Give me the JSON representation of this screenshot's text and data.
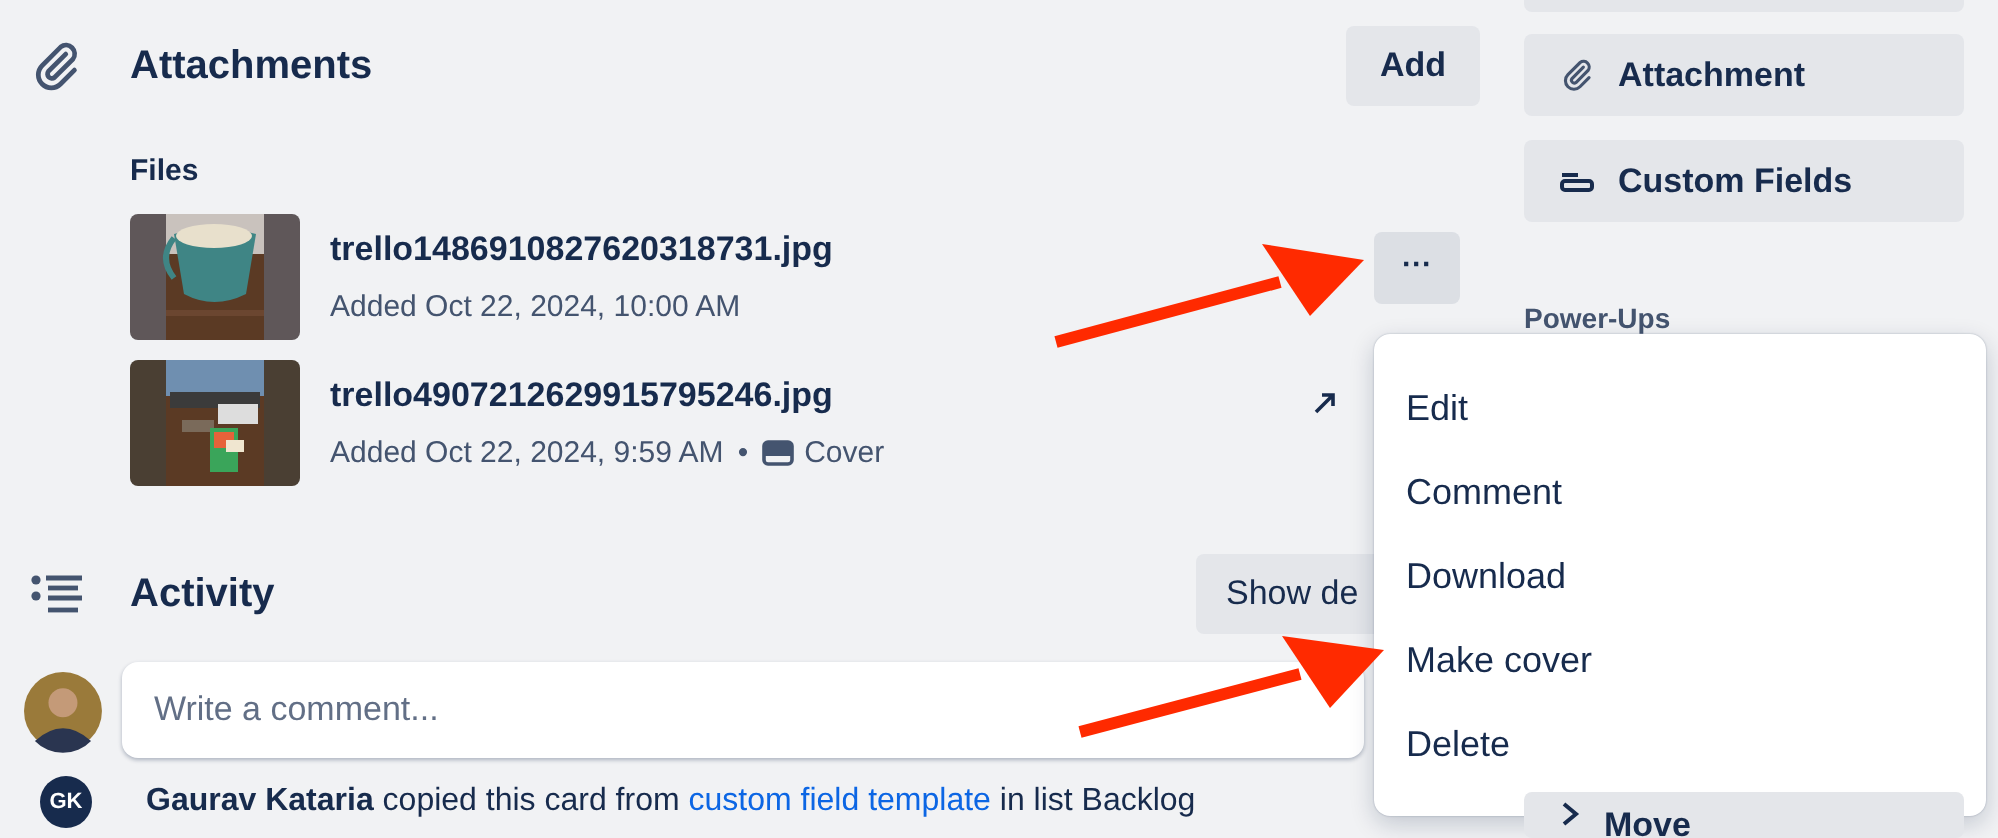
{
  "attachments": {
    "title": "Attachments",
    "add_button": "Add",
    "files_label": "Files",
    "files": [
      {
        "name": "trello1486910827620318731.jpg",
        "added": "Added Oct 22, 2024, 10:00 AM",
        "hovered": true,
        "more_button": "···"
      },
      {
        "name": "trello4907212629915795246.jpg",
        "added": "Added Oct 22, 2024, 9:59 AM",
        "hovered": false,
        "separator": "•",
        "cover_label": "Cover"
      }
    ]
  },
  "activity": {
    "title": "Activity",
    "details_button": "Show de",
    "comment_placeholder": "Write a comment...",
    "entries": [
      {
        "initials": "GK",
        "author": "Gaurav Kataria",
        "text_before": "copied this card from",
        "link": "custom field template",
        "text_after": "in list Backlog"
      }
    ]
  },
  "sidebar": {
    "buttons": [
      {
        "kind": "attachment",
        "label": "Attachment"
      },
      {
        "kind": "fields",
        "label": "Custom Fields"
      }
    ],
    "section_title": "Power-Ups",
    "bottom_button": "Move"
  },
  "menu": {
    "items": [
      "Edit",
      "Comment",
      "Download",
      "Make cover",
      "Delete"
    ]
  }
}
